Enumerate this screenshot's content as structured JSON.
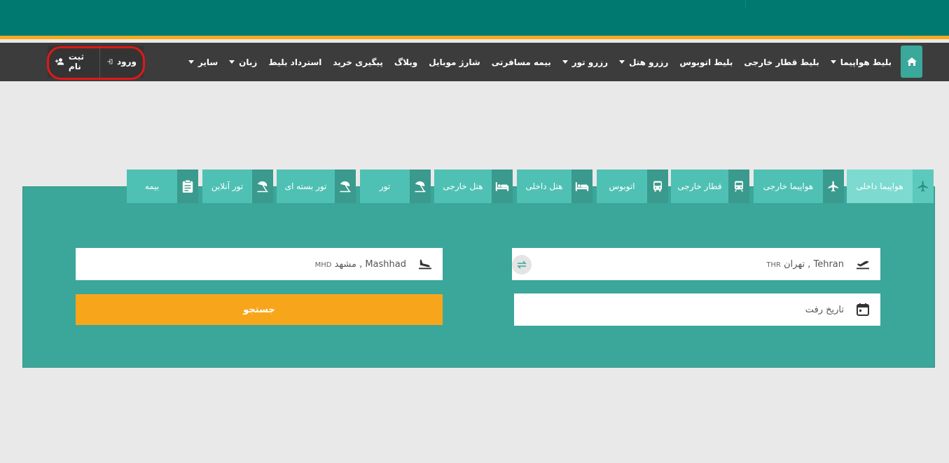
{
  "nav": {
    "items": [
      {
        "label": "بلیط هواپیما",
        "dropdown": true
      },
      {
        "label": "بلیط قطار خارجی",
        "dropdown": false
      },
      {
        "label": "بلیط اتوبوس",
        "dropdown": false
      },
      {
        "label": "رزرو هتل",
        "dropdown": true
      },
      {
        "label": "رزرو تور",
        "dropdown": true
      },
      {
        "label": "بیمه مسافرتی",
        "dropdown": false
      },
      {
        "label": "شارژ موبایل",
        "dropdown": false
      },
      {
        "label": "وبلاگ",
        "dropdown": false
      },
      {
        "label": "پیگیری خرید",
        "dropdown": false
      },
      {
        "label": "استرداد بلیط",
        "dropdown": false
      },
      {
        "label": "زبان",
        "dropdown": true
      },
      {
        "label": "سایر",
        "dropdown": true
      }
    ],
    "login_label": "ورود",
    "signup_label": "ثبت نام"
  },
  "tabs": [
    {
      "label": "هواپیما داخلی",
      "icon": "plane-icon",
      "active": true
    },
    {
      "label": "هواپیما خارجی",
      "icon": "plane-icon",
      "active": false
    },
    {
      "label": "قطار خارجی",
      "icon": "train-icon",
      "active": false
    },
    {
      "label": "اتوبوس",
      "icon": "bus-icon",
      "active": false
    },
    {
      "label": "هتل داخلی",
      "icon": "bed-icon",
      "active": false
    },
    {
      "label": "هتل خارجی",
      "icon": "bed-icon",
      "active": false
    },
    {
      "label": "تور",
      "icon": "beach-umbrella-icon",
      "active": false
    },
    {
      "label": "تور بسته ای",
      "icon": "beach-umbrella-icon",
      "active": false
    },
    {
      "label": "تور آنلاین",
      "icon": "beach-umbrella-icon",
      "active": false
    },
    {
      "label": "بیمه",
      "icon": "clipboard-icon",
      "active": false
    }
  ],
  "form": {
    "origin": {
      "name": "Tehran , تهران",
      "code": "THR"
    },
    "destination": {
      "name": "Mashhad , مشهد",
      "code": "MHD"
    },
    "date_placeholder": "تاریخ رفت",
    "search_label": "جستجو"
  },
  "colors": {
    "topbar": "#007a70",
    "accent": "#f5a91f",
    "navbar": "#3c3c3c",
    "panel": "#3ba69a",
    "tab": "#4ec1b4",
    "tab_active": "#7cdad0",
    "highlight_ring": "#e01818"
  }
}
